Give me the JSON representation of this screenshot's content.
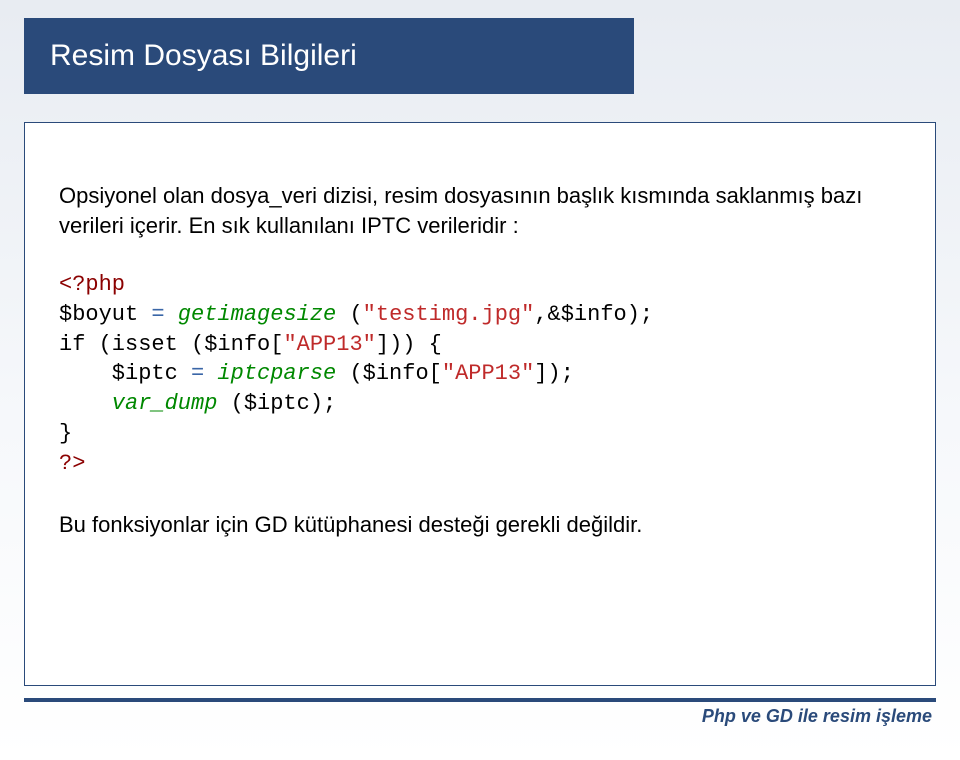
{
  "title": "Resim Dosyası Bilgileri",
  "intro": "Opsiyonel olan dosya_veri dizisi, resim dosyasının başlık kısmında saklanmış bazı verileri içerir. En sık kullanılanı IPTC verileridir :",
  "code": {
    "open_tag": "<?php",
    "var1": "$boyut ",
    "eq1": "= ",
    "fn1": "getimagesize ",
    "arg1a": "(",
    "str1": "\"testimg.jpg\"",
    "arg1b": ",&$info);",
    "if_kw": "if ",
    "if_cond": "(isset ($info[",
    "str2": "\"APP13\"",
    "if_cond_end": "])) {",
    "var2": "$iptc ",
    "eq2": "= ",
    "fn2": "iptcparse ",
    "arg2a": "($info[",
    "str3": "\"APP13\"",
    "arg2b": "]);",
    "fn3": "var_dump ",
    "arg3": "($iptc);",
    "brace": "}",
    "close_tag": "?>"
  },
  "outro": "Bu fonksiyonlar için GD kütüphanesi desteği gerekli değildir.",
  "footer": "Php ve GD ile resim işleme"
}
